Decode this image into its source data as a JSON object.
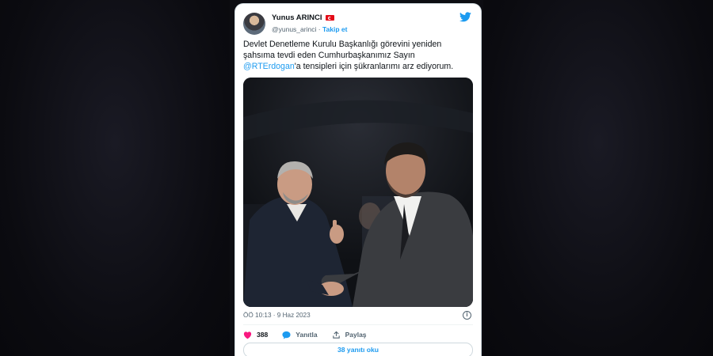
{
  "tweet": {
    "author_name": "Yunus ARINCI",
    "author_handle": "@yunus_arinci",
    "follow_label": "Takip et",
    "text_before_mention": "Devlet Denetleme Kurulu Başkanlığı görevini yeniden şahsıma tevdi eden Cumhurbaşkanımız Sayın ",
    "mention": "@RTErdogan",
    "text_after_mention": "'a tensipleri için şükranlarımı arz ediyorum.",
    "timestamp": "ÖÖ 10:13 · 9 Haz 2023",
    "likes_count": "388",
    "reply_label": "Yanıtla",
    "share_label": "Paylaş",
    "read_replies_label": "38 yanıtı oku"
  },
  "icons": [
    "flag-tr-icon",
    "twitter-bird-icon",
    "info-icon",
    "heart-icon",
    "reply-bubble-icon",
    "share-icon"
  ],
  "colors": {
    "accent": "#1d9bf0",
    "like": "#f91880",
    "text": "#0f1419",
    "secondary": "#536471",
    "background": "#0d0d12"
  }
}
